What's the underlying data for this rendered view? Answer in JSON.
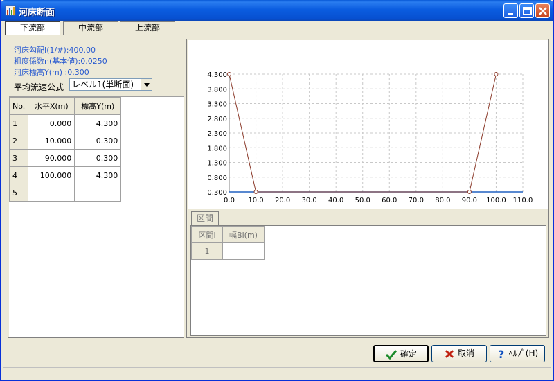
{
  "window": {
    "title": "河床断面"
  },
  "tabs": [
    {
      "label": "下流部",
      "active": true
    },
    {
      "label": "中流部",
      "active": false
    },
    {
      "label": "上流部",
      "active": false
    }
  ],
  "info": {
    "slope": "河床勾配I(1/#):400.00",
    "roughness": "粗度係数n(基本値):0.0250",
    "bed_height": "河床標高Y(m) :0.300",
    "formula_label": "平均流速公式",
    "formula_value": "レベル1(単断面)"
  },
  "grid": {
    "headers": [
      "No.",
      "水平X(m)",
      "標高Y(m)"
    ],
    "rows": [
      {
        "no": "1",
        "x": "0.000",
        "y": "4.300"
      },
      {
        "no": "2",
        "x": "10.000",
        "y": "0.300"
      },
      {
        "no": "3",
        "x": "90.000",
        "y": "0.300"
      },
      {
        "no": "4",
        "x": "100.000",
        "y": "4.300"
      },
      {
        "no": "5",
        "x": "",
        "y": ""
      }
    ]
  },
  "chart_data": {
    "type": "line",
    "x": [
      0,
      10,
      90,
      100
    ],
    "series": [
      {
        "values": [
          4.3,
          0.3,
          0.3,
          4.3
        ]
      }
    ],
    "xlim": [
      0,
      110
    ],
    "ylim": [
      0.3,
      4.3
    ],
    "x_ticks": [
      "0.0",
      "10.0",
      "20.0",
      "30.0",
      "40.0",
      "50.0",
      "60.0",
      "70.0",
      "80.0",
      "90.0",
      "100.0",
      "110.0"
    ],
    "y_ticks": [
      "0.300",
      "0.800",
      "1.300",
      "1.800",
      "2.300",
      "2.800",
      "3.300",
      "3.800",
      "4.300"
    ],
    "grid": true,
    "line_color": "#8b3a2a",
    "baseline_color": "#2060c0"
  },
  "section": {
    "tab_label": "区間",
    "headers": [
      "区間i",
      "幅Bi(m)"
    ],
    "rows": [
      {
        "i": "1",
        "width": ""
      }
    ]
  },
  "buttons": {
    "ok": "確定",
    "cancel": "取消",
    "help": "ﾍﾙﾌﾟ(H)"
  }
}
